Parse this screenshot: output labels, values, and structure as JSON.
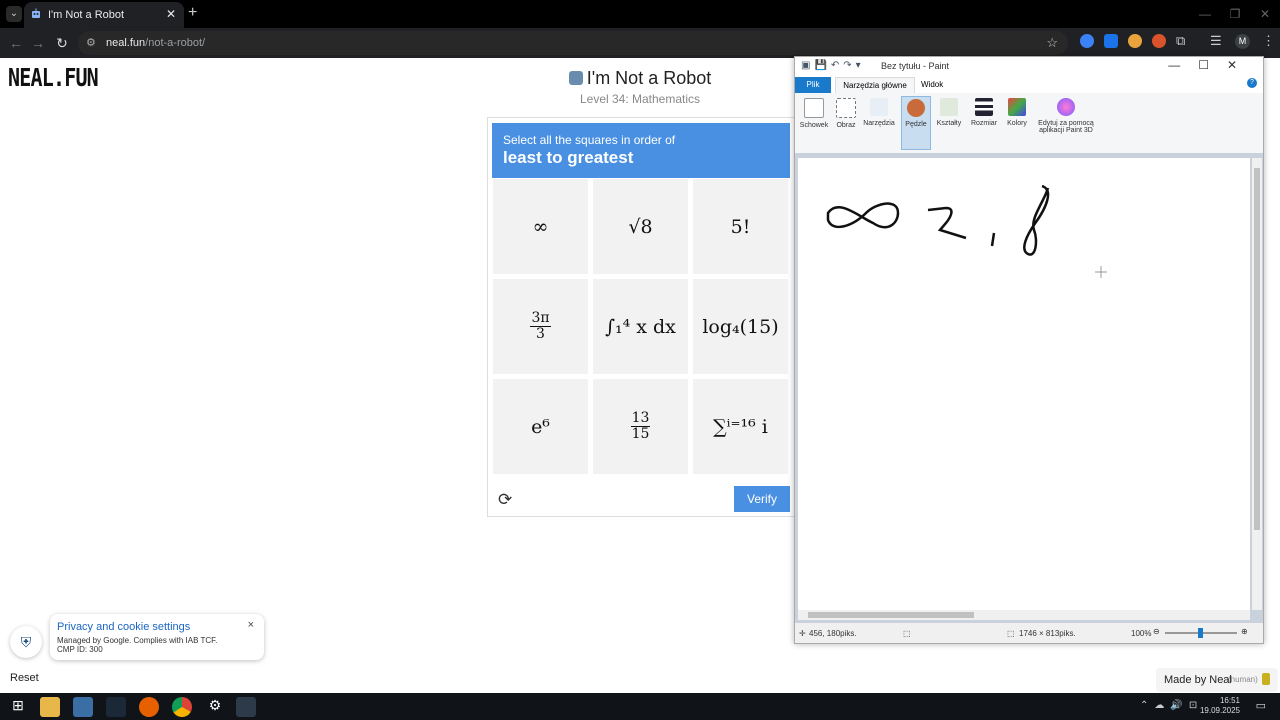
{
  "browser": {
    "tab_title": "I'm Not a Robot",
    "new_tab_label": "+",
    "address_domain": "neal.fun",
    "address_path": "/not-a-robot/",
    "profile_initial": "M"
  },
  "page": {
    "logo": "NEAL.FUN",
    "game_title": "I'm Not a Robot",
    "level": "Level 34: Mathematics",
    "prompt_line1": "Select all the squares in order of",
    "prompt_line2": "least to greatest",
    "verify_label": "Verify",
    "reset_label": "Reset",
    "made_by": "Made by Neal",
    "made_by_note": "(human)"
  },
  "tiles": [
    {
      "label": "∞"
    },
    {
      "label": "√8"
    },
    {
      "label": "5!"
    },
    {
      "num": "3π",
      "den": "3"
    },
    {
      "label": "∫₁⁴ x dx"
    },
    {
      "label": "log₄(15)"
    },
    {
      "label": "e⁶"
    },
    {
      "num": "13",
      "den": "15"
    },
    {
      "label": "∑ⁱ⁼¹⁶ i"
    }
  ],
  "cookie": {
    "title": "Privacy and cookie settings",
    "line1": "Managed by Google. Complies with IAB TCF.",
    "line2": "CMP ID: 300",
    "close": "×"
  },
  "paint": {
    "title": "Bez tytułu - Paint",
    "tab_file": "Plik",
    "tab_home": "Narzędzia główne",
    "tab_view": "Widok",
    "groups": {
      "clipboard": "Schowek",
      "image": "Obraz",
      "tools": "Narzędzia",
      "brushes": "Pędzle",
      "shapes": "Kształty",
      "size": "Rozmiar",
      "colors": "Kolory",
      "paint3d_1": "Edytuj za pomocą",
      "paint3d_2": "aplikacji Paint 3D"
    },
    "status_cursor": "456, 180piks.",
    "status_size": "1746 × 813piks.",
    "zoom": "100%"
  },
  "taskbar": {
    "time": "16:51",
    "date": "19.09.2025"
  }
}
